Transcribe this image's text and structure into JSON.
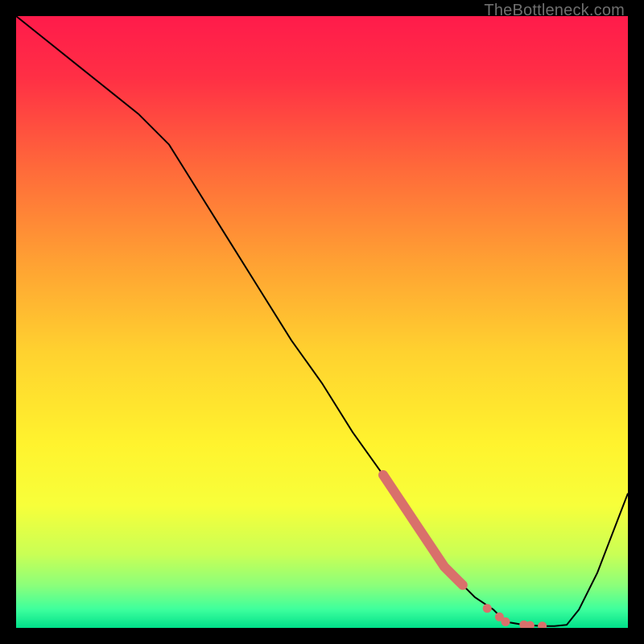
{
  "watermark": "TheBottleneck.com",
  "chart_data": {
    "type": "line",
    "title": "",
    "xlabel": "",
    "ylabel": "",
    "xlim": [
      0,
      100
    ],
    "ylim": [
      0,
      100
    ],
    "x": [
      0,
      5,
      10,
      15,
      20,
      25,
      30,
      35,
      40,
      45,
      50,
      55,
      60,
      65,
      70,
      72,
      75,
      78,
      80,
      83,
      86,
      88,
      90,
      92,
      95,
      100
    ],
    "values": [
      100,
      96,
      92,
      88,
      84,
      79,
      71,
      63,
      55,
      47,
      40,
      32,
      25,
      17,
      10,
      8,
      5,
      3,
      1,
      0.5,
      0.3,
      0.3,
      0.5,
      3,
      9,
      22
    ],
    "highlight_segment": {
      "x": [
        60,
        62,
        64,
        66,
        68,
        70,
        72,
        73
      ],
      "values": [
        25,
        22,
        19,
        16,
        13,
        10,
        8,
        7
      ]
    },
    "highlight_dots": {
      "x": [
        77,
        79,
        80,
        83,
        84,
        86
      ],
      "values": [
        3.2,
        1.8,
        1.0,
        0.5,
        0.4,
        0.3
      ]
    },
    "gradient_stops": [
      {
        "offset": 0.0,
        "color": "#ff1b4b"
      },
      {
        "offset": 0.1,
        "color": "#ff2f45"
      },
      {
        "offset": 0.25,
        "color": "#ff6a3a"
      },
      {
        "offset": 0.4,
        "color": "#ffa033"
      },
      {
        "offset": 0.55,
        "color": "#ffd22f"
      },
      {
        "offset": 0.7,
        "color": "#fff32e"
      },
      {
        "offset": 0.8,
        "color": "#f7ff3a"
      },
      {
        "offset": 0.88,
        "color": "#c9ff55"
      },
      {
        "offset": 0.93,
        "color": "#8cff7a"
      },
      {
        "offset": 0.97,
        "color": "#3dff9d"
      },
      {
        "offset": 1.0,
        "color": "#00e08a"
      }
    ],
    "line_color": "#000000",
    "highlight_color": "#d9706b"
  }
}
